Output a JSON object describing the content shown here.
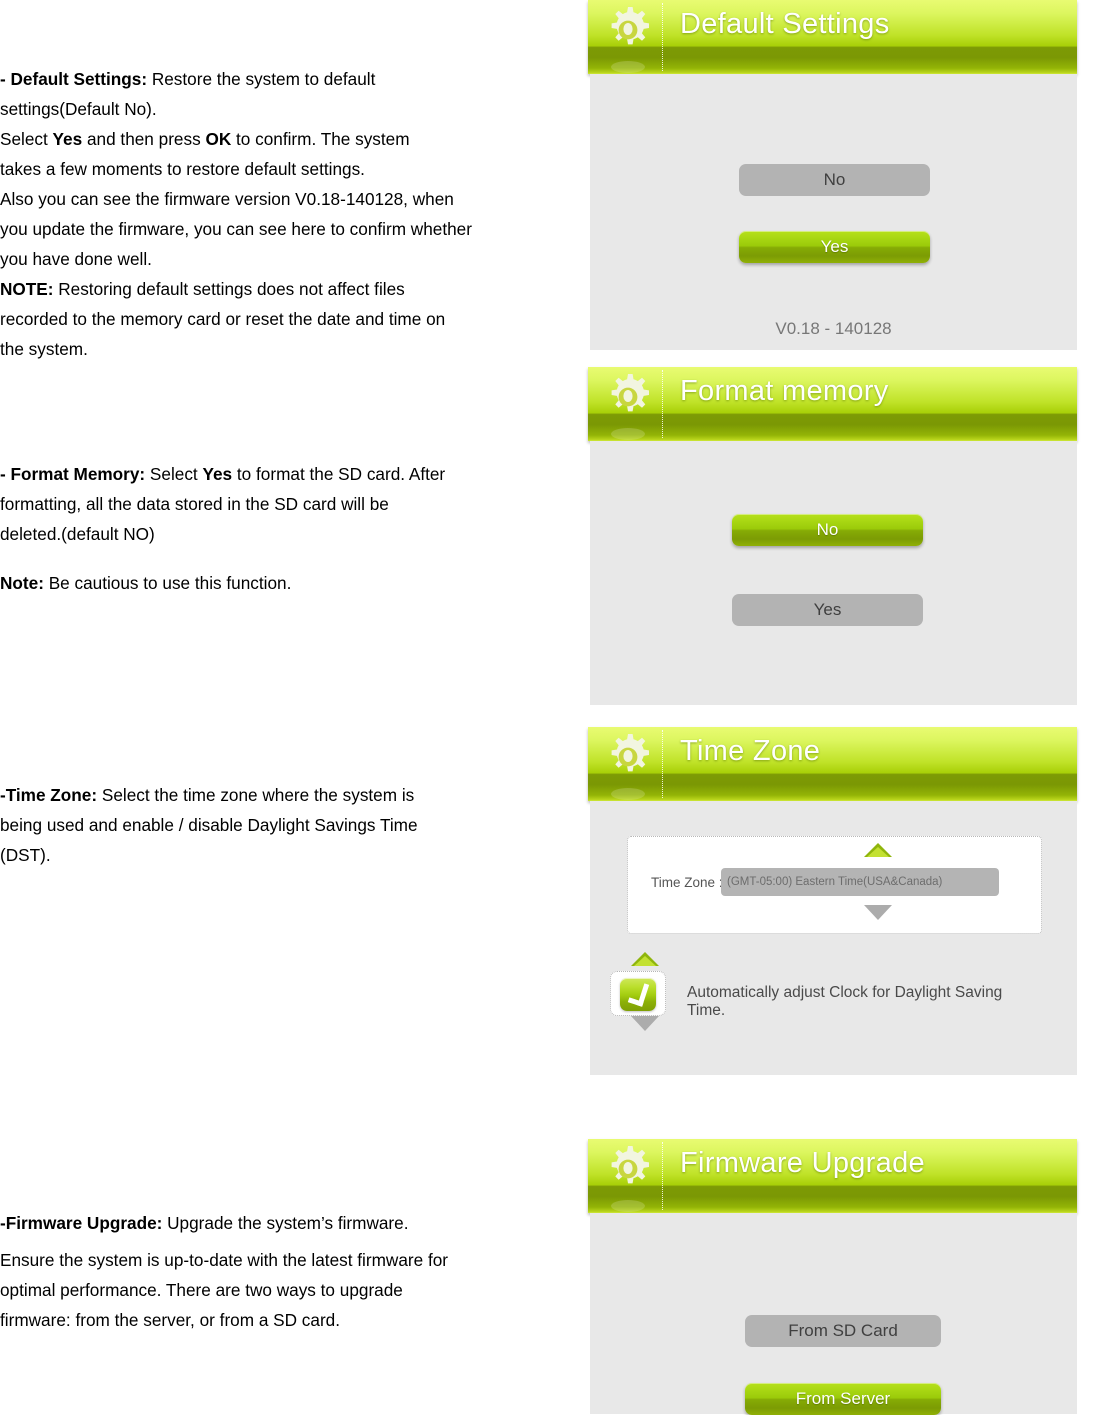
{
  "document": {
    "sections": [
      {
        "id": "default-settings",
        "lines": [
          {
            "bold": "- Default Settings:",
            "rest": " Restore the system to default"
          },
          {
            "bold": "",
            "rest": "settings(Default No)."
          },
          {
            "bold": "",
            "rest": "Select "
          },
          {
            "bold": "",
            "rest": "takes a few moments to restore default settings."
          },
          {
            "bold": "",
            "rest": "Also you can see the firmware version V0.18-140128, when"
          },
          {
            "bold": "",
            "rest": "you update the firmware, you can see here to confirm whether"
          },
          {
            "bold": "",
            "rest": "you have done well."
          },
          {
            "bold": "NOTE:",
            "rest": " Restoring default settings does not affect files"
          },
          {
            "bold": "",
            "rest": "recorded to the memory card or reset the date and time on"
          },
          {
            "bold": "",
            "rest": "the system."
          }
        ],
        "line1_bold": "- Default Settings:",
        "line1_rest": " Restore the system to default",
        "line2": "settings(Default No).",
        "line3_a": "Select ",
        "line3_b": "Yes",
        "line3_c": " and then press ",
        "line3_d": "OK",
        "line3_e": " to confirm. The system",
        "line4": "takes a few moments to restore default settings.",
        "line5": "Also you can see the firmware version V0.18-140128, when",
        "line6": "you update the firmware, you can see here to confirm whether",
        "line7": "you have done well.",
        "line8_bold": "NOTE:",
        "line8_rest": " Restoring default settings does not affect files",
        "line9": "recorded to the memory card or reset the date and time on",
        "line10": "the system."
      },
      {
        "id": "format-memory",
        "line1_bold": "- Format Memory:",
        "line1_a": " Select ",
        "line1_b": "Yes",
        "line1_c": " to format the SD card. After",
        "line2": "formatting, all the data stored in the SD card will be",
        "line3": "deleted.(default NO)",
        "note_bold": "Note:",
        "note_rest": " Be cautious to use this function."
      },
      {
        "id": "time-zone",
        "line1_bold": "-Time Zone:",
        "line1_rest": " Select the time zone where the system is",
        "line2": "being used and enable / disable Daylight Savings Time",
        "line3": "(DST)."
      },
      {
        "id": "firmware-upgrade",
        "line1_bold": "-Firmware    Upgrade:",
        "line1_rest": " Upgrade the system’s firmware.",
        "line2": "Ensure the system is up-to-date with the latest firmware for",
        "line3": "optimal performance. There are two ways to upgrade",
        "line4": "firmware: from the server, or from a SD card."
      }
    ]
  },
  "screens": [
    {
      "id": "default-settings-screen",
      "title": "Default Settings",
      "icon": "gear-icon",
      "buttons": [
        {
          "label": "No",
          "state": "unselected"
        },
        {
          "label": "Yes",
          "state": "selected"
        }
      ],
      "version": "V0.18 - 140128"
    },
    {
      "id": "format-memory-screen",
      "title": "Format memory",
      "icon": "gear-icon",
      "buttons": [
        {
          "label": "No",
          "state": "selected"
        },
        {
          "label": "Yes",
          "state": "unselected"
        }
      ]
    },
    {
      "id": "time-zone-screen",
      "title": "Time Zone",
      "icon": "gear-icon",
      "field_label": "Time Zone :",
      "field_value": "(GMT-05:00) Eastern Time(USA&Canada)",
      "dst_label": "Automatically adjust Clock for Daylight Saving Time.",
      "dst_checked": true
    },
    {
      "id": "firmware-upgrade-screen",
      "title": "Firmware Upgrade",
      "icon": "gear-icon",
      "buttons": [
        {
          "label": "From SD Card",
          "state": "unselected"
        },
        {
          "label": "From Server",
          "state": "selected"
        }
      ]
    }
  ],
  "colors": {
    "header_green_light": "#e9fb72",
    "header_green_mid": "#bfe227",
    "header_green_dark": "#7b9804",
    "button_green": "#a3cd10",
    "button_gray": "#b3b3b3",
    "panel_body": "#e8e8e8",
    "text_dark": "#3f3f3f"
  }
}
